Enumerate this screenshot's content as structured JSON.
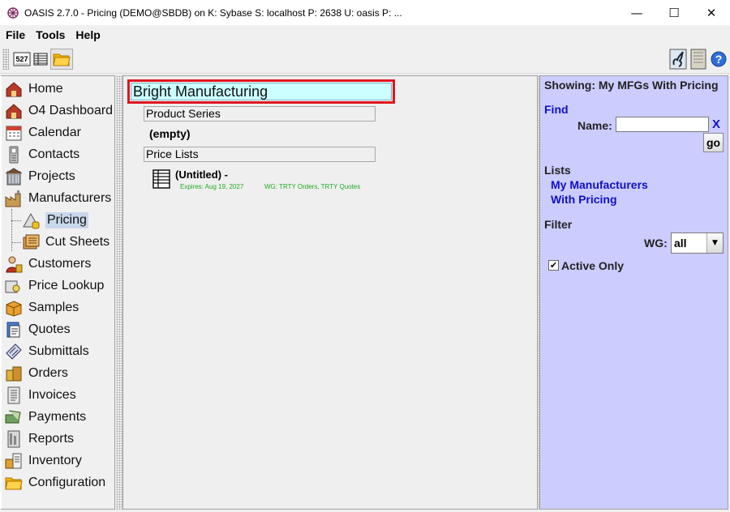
{
  "window": {
    "title": "OASIS 2.7.0 - Pricing (DEMO@SBDB) on K: Sybase  S: localhost  P: 2638  U: oasis  P: ...",
    "minimize": "—",
    "maximize": "☐",
    "close": "✕"
  },
  "menu": {
    "file": "File",
    "tools": "Tools",
    "help": "Help"
  },
  "toolbar": {
    "sheet_label": "527"
  },
  "nav": {
    "items": [
      {
        "label": "Home",
        "icon": "house-icon"
      },
      {
        "label": "O4 Dashboard",
        "icon": "house-icon"
      },
      {
        "label": "Calendar",
        "icon": "calendar-icon"
      },
      {
        "label": "Contacts",
        "icon": "phone-icon"
      },
      {
        "label": "Projects",
        "icon": "building-icon"
      },
      {
        "label": "Manufacturers",
        "icon": "factory-icon"
      },
      {
        "label": "Pricing",
        "icon": "pricing-icon"
      },
      {
        "label": "Cut Sheets",
        "icon": "sheets-icon"
      },
      {
        "label": "Customers",
        "icon": "person-icon"
      },
      {
        "label": "Price Lookup",
        "icon": "lookup-icon"
      },
      {
        "label": "Samples",
        "icon": "box-icon"
      },
      {
        "label": "Quotes",
        "icon": "quote-icon"
      },
      {
        "label": "Submittals",
        "icon": "submittal-icon"
      },
      {
        "label": "Orders",
        "icon": "orders-icon"
      },
      {
        "label": "Invoices",
        "icon": "invoice-icon"
      },
      {
        "label": "Payments",
        "icon": "payment-icon"
      },
      {
        "label": "Reports",
        "icon": "report-icon"
      },
      {
        "label": "Inventory",
        "icon": "inventory-icon"
      },
      {
        "label": "Configuration",
        "icon": "folder-icon"
      }
    ]
  },
  "center": {
    "manufacturer": "Bright Manufacturing",
    "product_series_header": "Product Series",
    "product_series_empty": "(empty)",
    "price_lists_header": "Price Lists",
    "price_list": {
      "name": "(Untitled)",
      "dash": "-",
      "expires": "Expires: Aug 19, 2027",
      "wg": "WG: TRTY Orders, TRTY Quotes"
    }
  },
  "right": {
    "showing": "Showing: My MFGs With Pricing",
    "find": "Find",
    "name_label": "Name:",
    "name_value": "",
    "clear": "X",
    "go": "go",
    "lists": "Lists",
    "list_links": [
      "My Manufacturers",
      "With Pricing"
    ],
    "filter": "Filter",
    "wg_label": "WG:",
    "wg_value": "all",
    "active_only": "Active Only",
    "active_only_checked": "✔"
  },
  "colors": {
    "selected_highlight": "#c9d7ec",
    "right_panel_bg": "#ccccff",
    "title_field_bg": "#ccffff",
    "title_field_border": "#e0141e",
    "link_blue": "#1010c8",
    "green_meta": "#22aa22"
  }
}
